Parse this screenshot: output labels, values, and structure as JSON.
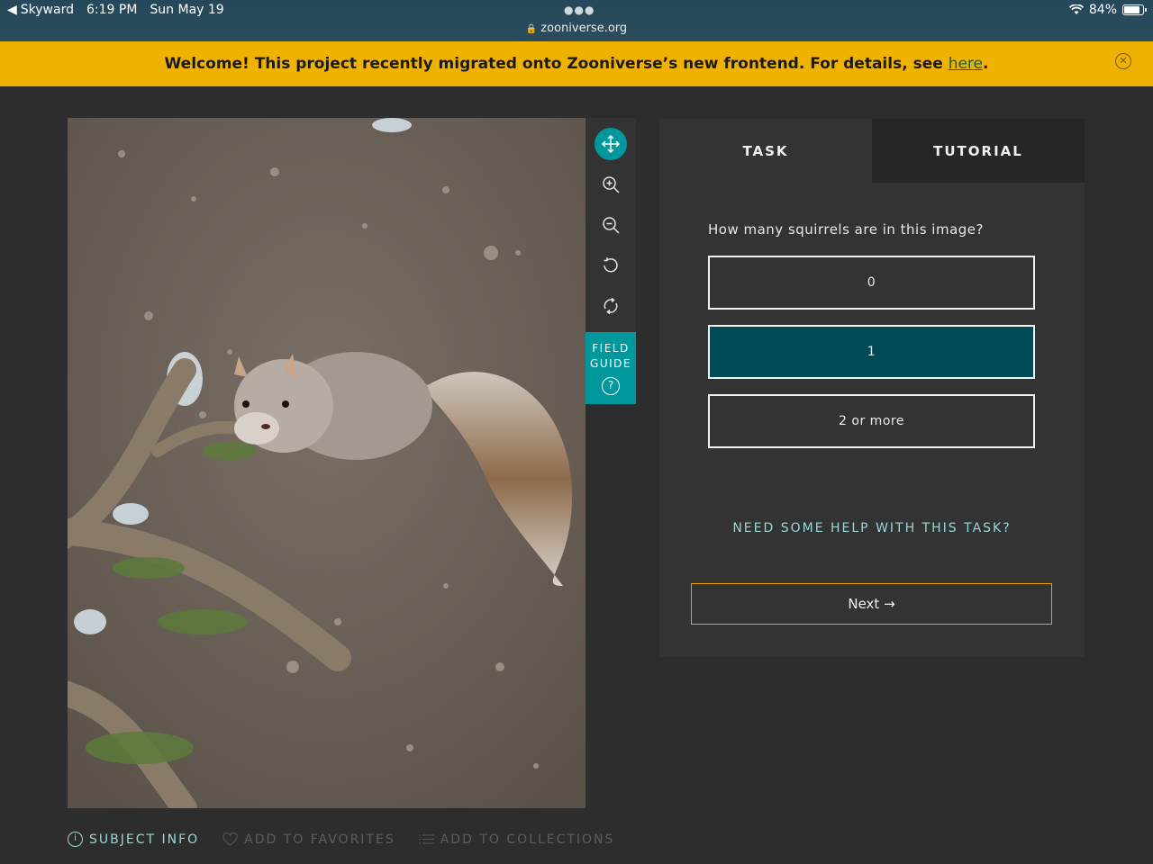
{
  "status_bar": {
    "back_app": "Skyward",
    "time": "6:19 PM",
    "date": "Sun May 19",
    "url": "zooniverse.org",
    "battery": "84%",
    "battery_level": 0.84
  },
  "banner": {
    "text": "Welcome! This project recently migrated onto Zooniverse’s new frontend. For details, see ",
    "link_text": "here",
    "suffix": "."
  },
  "toolbar": {
    "tools": [
      "move-icon",
      "zoom-in-icon",
      "zoom-out-icon",
      "rotate-icon",
      "reset-icon"
    ],
    "field_guide_line1": "FIELD",
    "field_guide_line2": "GUIDE",
    "field_guide_icon": "?"
  },
  "panel": {
    "tabs": [
      {
        "label": "TASK",
        "active": true
      },
      {
        "label": "TUTORIAL",
        "active": false
      }
    ],
    "question": "How many squirrels are in this image?",
    "answers": [
      {
        "label": "0",
        "selected": false
      },
      {
        "label": "1",
        "selected": true
      },
      {
        "label": "2 or more",
        "selected": false
      }
    ],
    "help_link": "NEED SOME HELP WITH THIS TASK?",
    "next_label": "Next →"
  },
  "meta": {
    "subject_info": "SUBJECT INFO",
    "favorites": "ADD TO FAVORITES",
    "collections": "ADD TO COLLECTIONS"
  },
  "colors": {
    "accent_teal": "#00979d",
    "selected_answer": "#004b57",
    "banner": "#f0b200",
    "next_border": "#e6a600"
  }
}
